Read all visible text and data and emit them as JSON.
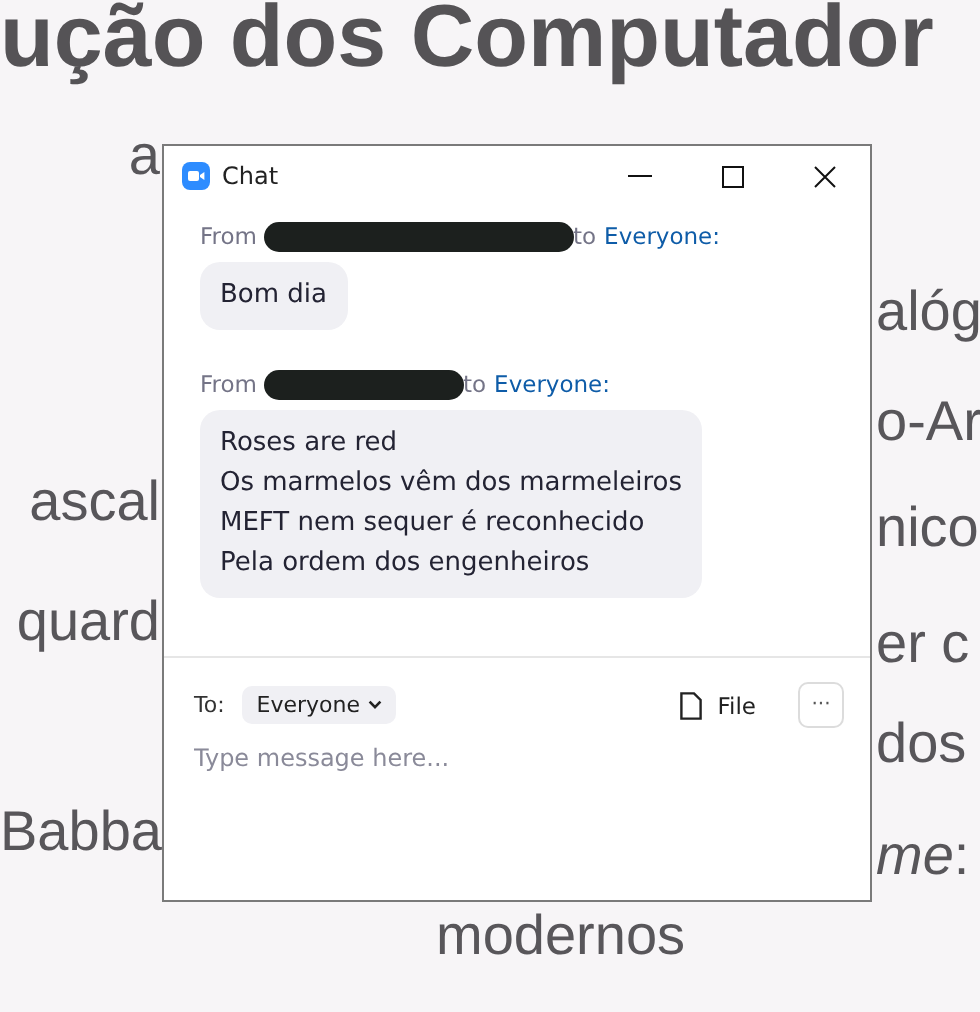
{
  "backdrop": {
    "texts": [
      {
        "text": "ução dos Computador",
        "kind": "title"
      },
      {
        "text": "a",
        "kind": "left"
      },
      {
        "text": "alóg",
        "kind": "right"
      },
      {
        "text": "o-Ar",
        "kind": "right"
      },
      {
        "text": "ascal",
        "kind": "left"
      },
      {
        "text": "nico",
        "kind": "right"
      },
      {
        "text": "quard",
        "kind": "left"
      },
      {
        "text": "er c",
        "kind": "right"
      },
      {
        "text": "dos",
        "kind": "right"
      },
      {
        "text": "Babba",
        "kind": "left"
      },
      {
        "text": "*me*:",
        "kind": "right"
      },
      {
        "text": "modernos",
        "kind": "bottom"
      }
    ]
  },
  "window": {
    "title": "Chat",
    "messages": [
      {
        "from": "From",
        "to": "to",
        "recipient": "Everyone:",
        "lines": [
          "Bom dia"
        ]
      },
      {
        "from": "From",
        "to": "to",
        "recipient": "Everyone:",
        "lines": [
          "Roses are red",
          "Os marmelos vêm dos marmeleiros",
          "MEFT nem sequer é reconhecido",
          "Pela ordem dos engenheiros"
        ]
      }
    ],
    "composer": {
      "to_label": "To:",
      "recipient": "Everyone",
      "file": "File",
      "more": "···",
      "placeholder": "Type message here..."
    }
  }
}
